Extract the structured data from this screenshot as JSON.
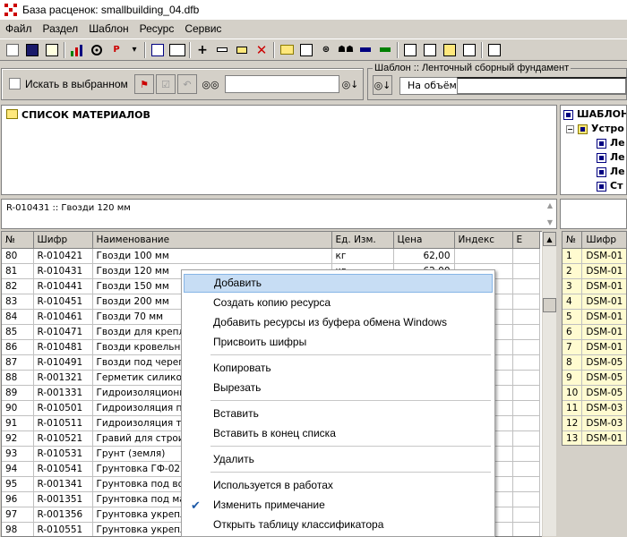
{
  "window": {
    "title": "База расценок:  smallbuilding_04.dfb"
  },
  "menu": [
    "Файл",
    "Раздел",
    "Шаблон",
    "Ресурс",
    "Сервис"
  ],
  "filter": {
    "search_selected_label": "Искать в выбранном",
    "search_value": "",
    "template_group_label": "Шаблон :: Ленточный сборный фундамент",
    "volume_label": "На объём:",
    "volume_value": ""
  },
  "materials_panel": {
    "title": "СПИСОК МАТЕРИАЛОВ"
  },
  "templates_panel": {
    "title": "ШАБЛОНЫ",
    "root": "Устро",
    "items": [
      "Ле",
      "Ле",
      "Ле",
      "Ст"
    ]
  },
  "note": {
    "text": "R-010431 :: Гвозди 120 мм"
  },
  "grid": {
    "columns": [
      "№",
      "Шифр",
      "Наименование",
      "Ед. Изм.",
      "Цена",
      "Индекс",
      "Е"
    ],
    "rows": [
      {
        "n": "80",
        "code": "R-010421",
        "name": "Гвозди 100 мм",
        "unit": "кг",
        "price": "62,00"
      },
      {
        "n": "81",
        "code": "R-010431",
        "name": "Гвозди 120 мм",
        "unit": "кг",
        "price": "62,00"
      },
      {
        "n": "82",
        "code": "R-010441",
        "name": "Гвозди 150 мм",
        "unit": "",
        "price": ""
      },
      {
        "n": "83",
        "code": "R-010451",
        "name": "Гвозди 200 мм",
        "unit": "",
        "price": ""
      },
      {
        "n": "84",
        "code": "R-010461",
        "name": "Гвозди 70 мм",
        "unit": "",
        "price": ""
      },
      {
        "n": "85",
        "code": "R-010471",
        "name": "Гвозди для крепле",
        "unit": "",
        "price": ""
      },
      {
        "n": "86",
        "code": "R-010481",
        "name": "Гвозди кровельны",
        "unit": "",
        "price": ""
      },
      {
        "n": "87",
        "code": "R-010491",
        "name": "Гвозди под черепи",
        "unit": "",
        "price": ""
      },
      {
        "n": "88",
        "code": "R-001321",
        "name": "Герметик силикон",
        "unit": "",
        "price": ""
      },
      {
        "n": "89",
        "code": "R-001331",
        "name": "Гидроизоляционны",
        "unit": "",
        "price": ""
      },
      {
        "n": "90",
        "code": "R-010501",
        "name": "Гидроизоляция по",
        "unit": "",
        "price": ""
      },
      {
        "n": "91",
        "code": "R-010511",
        "name": "Гидроизоляция те",
        "unit": "",
        "price": ""
      },
      {
        "n": "92",
        "code": "R-010521",
        "name": "Гравий для строит",
        "unit": "",
        "price": ""
      },
      {
        "n": "93",
        "code": "R-010531",
        "name": "Грунт (земля)",
        "unit": "",
        "price": ""
      },
      {
        "n": "94",
        "code": "R-010541",
        "name": "Грунтовка ГФ-021",
        "unit": "",
        "price": ""
      },
      {
        "n": "95",
        "code": "R-001341",
        "name": "Грунтовка под вод",
        "unit": "",
        "price": ""
      },
      {
        "n": "96",
        "code": "R-001351",
        "name": "Грунтовка под ма",
        "unit": "",
        "price": ""
      },
      {
        "n": "97",
        "code": "R-001356",
        "name": "Грунтовка укрепл",
        "unit": "",
        "price": ""
      },
      {
        "n": "98",
        "code": "R-010551",
        "name": "Грунтовка укрепл",
        "unit": "",
        "price": ""
      }
    ]
  },
  "right_grid": {
    "columns": [
      "№",
      "Шифр"
    ],
    "rows": [
      {
        "n": "1",
        "code": "DSM-01"
      },
      {
        "n": "2",
        "code": "DSM-01"
      },
      {
        "n": "3",
        "code": "DSM-01"
      },
      {
        "n": "4",
        "code": "DSM-01"
      },
      {
        "n": "5",
        "code": "DSM-01"
      },
      {
        "n": "6",
        "code": "DSM-01"
      },
      {
        "n": "7",
        "code": "DSM-01"
      },
      {
        "n": "8",
        "code": "DSM-05"
      },
      {
        "n": "9",
        "code": "DSM-05"
      },
      {
        "n": "10",
        "code": "DSM-05"
      },
      {
        "n": "11",
        "code": "DSM-03"
      },
      {
        "n": "12",
        "code": "DSM-03"
      },
      {
        "n": "13",
        "code": "DSM-01"
      }
    ]
  },
  "context_menu": {
    "items": [
      {
        "label": "Добавить",
        "highlighted": true
      },
      {
        "label": "Создать копию ресурса"
      },
      {
        "label": "Добавить ресурсы из буфера обмена Windows"
      },
      {
        "label": "Присвоить шифры"
      },
      {
        "label": "Копировать"
      },
      {
        "label": "Вырезать"
      },
      {
        "label": "Вставить"
      },
      {
        "label": "Вставить в конец списка"
      },
      {
        "label": "Удалить"
      },
      {
        "label": "Используется в работах"
      },
      {
        "label": "Изменить примечание",
        "checked": true
      },
      {
        "label": "Открыть таблицу классификатора"
      }
    ]
  },
  "colors": {
    "face": "#d4d0c8",
    "highlight": "#c7ddf4",
    "yellow_cells": "#fffbd0"
  }
}
